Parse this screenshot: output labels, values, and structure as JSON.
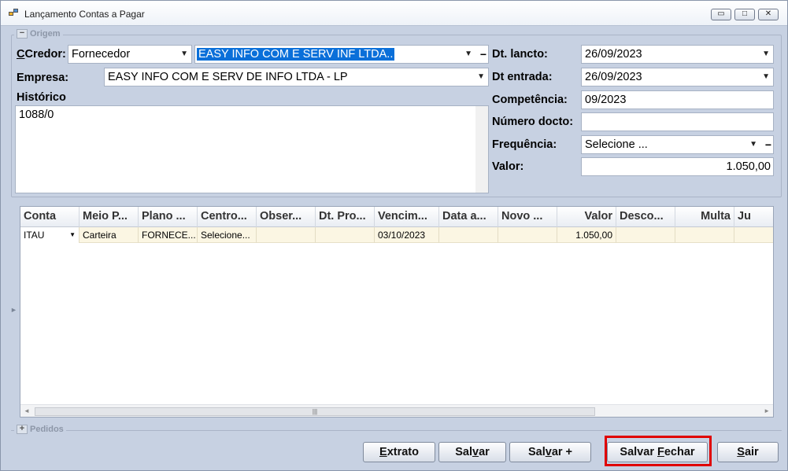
{
  "window": {
    "title": "Lançamento Contas a Pagar",
    "minimize": "▭",
    "maximize": "□",
    "close": "✕"
  },
  "origem": {
    "group_label": "Origem",
    "toggle": "−",
    "credor_label": "Credor:",
    "credor_type": "Fornecedor",
    "credor_name": "EASY INFO COM E SERV INF LTDA..",
    "empresa_label": "Empresa:",
    "empresa_value": "EASY INFO COM E SERV DE INFO LTDA - LP",
    "historico_label": "Histórico",
    "historico_value": "1088/0",
    "dt_lancto_label": "Dt. lancto:",
    "dt_lancto_value": "26/09/2023",
    "dt_entrada_label": "Dt entrada:",
    "dt_entrada_value": "26/09/2023",
    "competencia_label": "Competência:",
    "competencia_value": "09/2023",
    "numero_docto_label": "Número docto:",
    "numero_docto_value": "",
    "frequencia_label": "Frequência:",
    "frequencia_value": "Selecione ...",
    "valor_label": "Valor:",
    "valor_value": "1.050,00"
  },
  "grid": {
    "columns": [
      "Conta",
      "Meio P...",
      "Plano ...",
      "Centro...",
      "Obser...",
      "Dt. Pro...",
      "Vencim...",
      "Data a...",
      "Novo ...",
      "Valor",
      "Desco...",
      "Multa",
      "Ju"
    ],
    "row": [
      "ITAU",
      "Carteira",
      "FORNECE...",
      "Selecione...",
      "",
      "",
      "03/10/2023",
      "",
      "",
      "1.050,00",
      "",
      "",
      ""
    ],
    "scroll_grip": "|||"
  },
  "pedidos": {
    "group_label": "Pedidos",
    "toggle": "+"
  },
  "buttons": {
    "extrato": "Extrato",
    "salvar": "Salvar",
    "salvar_mais": "Salvar +",
    "salvar_fechar": "Salvar Fechar",
    "sair": "Sair"
  },
  "icons": {
    "dropdown": "▼",
    "collapse": "−",
    "expand": "+",
    "sidebar_arrow": "►"
  },
  "colors": {
    "window_bg": "#c7d1e2",
    "selection": "#0a6fd9",
    "row_highlight": "#fbf6e3",
    "highlight_box": "#e00000"
  }
}
